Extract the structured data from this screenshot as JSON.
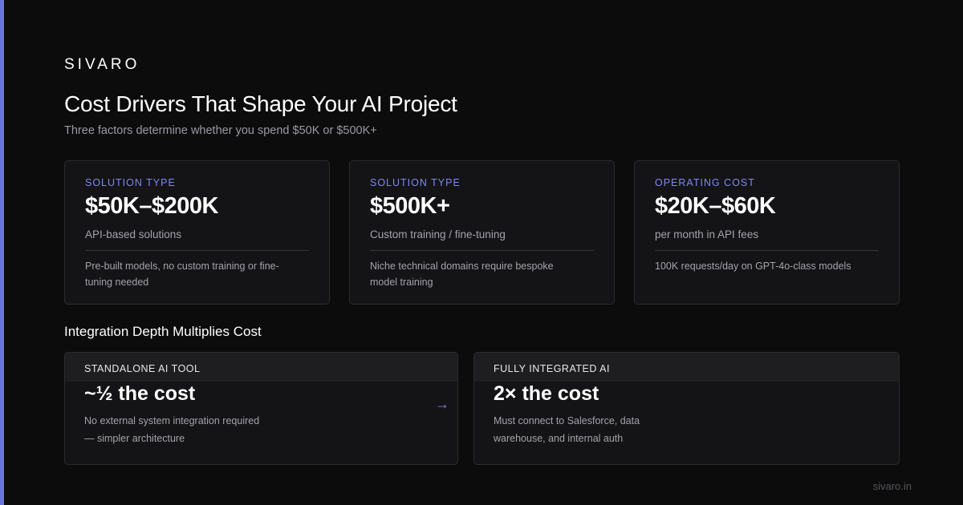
{
  "brand": "SIVARO",
  "title": "Cost Drivers That Shape Your AI Project",
  "subtitle": "Three factors determine whether you spend $50K or $500K+",
  "cards": [
    {
      "label": "SOLUTION TYPE",
      "value": "$50K–$200K",
      "caption": "API-based solutions",
      "note": "Pre-built models, no custom training or fine-tuning needed"
    },
    {
      "label": "SOLUTION TYPE",
      "value": "$500K+",
      "caption": "Custom training / fine-tuning",
      "note": "Niche technical domains require bespoke model training"
    },
    {
      "label": "OPERATING COST",
      "value": "$20K–$60K",
      "caption": "per month in API fees",
      "note": "100K requests/day on GPT-4o-class models"
    }
  ],
  "integration": {
    "heading": "Integration Depth Multiplies Cost",
    "arrow": "→",
    "items": [
      {
        "header": "STANDALONE AI TOOL",
        "value": "~½ the cost",
        "description": "No external system integration required — simpler architecture"
      },
      {
        "header": "FULLY INTEGRATED AI",
        "value": "2× the cost",
        "description": "Must connect to Salesforce, data warehouse, and internal auth"
      }
    ]
  },
  "footer": "sivaro.in",
  "colors": {
    "background": "#0c0c0d",
    "accent": "#6a75e0",
    "label_accent": "#7f89ee",
    "card_background": "#141416"
  }
}
